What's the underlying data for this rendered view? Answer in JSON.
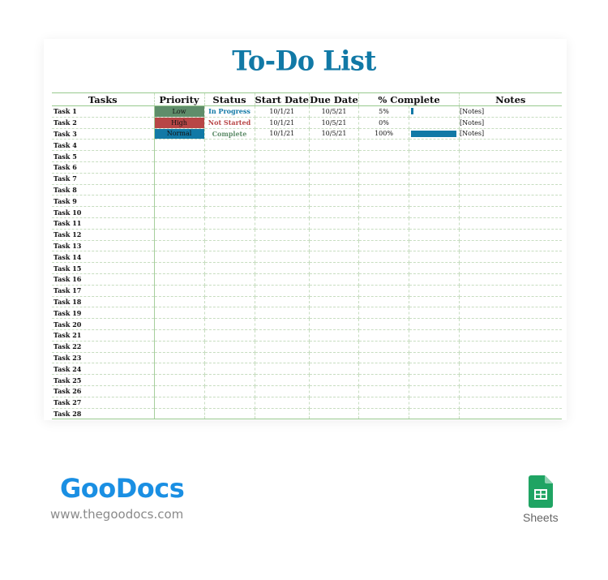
{
  "title": "To-Do List",
  "columns": {
    "tasks": "Tasks",
    "priority": "Priority",
    "status": "Status",
    "start_date": "Start Date",
    "due_date": "Due Date",
    "percent_complete": "% Complete",
    "notes": "Notes"
  },
  "colors": {
    "accent": "#1179a6",
    "priority_low": "#5f8d6a",
    "priority_high": "#b84646",
    "priority_normal": "#1179a6",
    "status_in_progress": "#1179a6",
    "status_not_started": "#b84646",
    "status_complete": "#5f8d6a",
    "grid_line": "#98c98e"
  },
  "rows": [
    {
      "task": "Task 1",
      "priority": "Low",
      "priority_key": "low",
      "status": "In Progress",
      "status_key": "in_progress",
      "start": "10/1/21",
      "due": "10/5/21",
      "pct_label": "5%",
      "pct": 0.05,
      "notes": "[Notes]"
    },
    {
      "task": "Task 2",
      "priority": "High",
      "priority_key": "high",
      "status": "Not Started",
      "status_key": "not_started",
      "start": "10/1/21",
      "due": "10/5/21",
      "pct_label": "0%",
      "pct": 0,
      "notes": "[Notes]"
    },
    {
      "task": "Task 3",
      "priority": "Normal",
      "priority_key": "normal",
      "status": "Complete",
      "status_key": "complete",
      "start": "10/1/21",
      "due": "10/5/21",
      "pct_label": "100%",
      "pct": 1.0,
      "notes": "[Notes]"
    },
    {
      "task": "Task 4"
    },
    {
      "task": "Task 5"
    },
    {
      "task": "Task 6"
    },
    {
      "task": "Task 7"
    },
    {
      "task": "Task 8"
    },
    {
      "task": "Task 9"
    },
    {
      "task": "Task 10"
    },
    {
      "task": "Task 11"
    },
    {
      "task": "Task 12"
    },
    {
      "task": "Task 13"
    },
    {
      "task": "Task 14"
    },
    {
      "task": "Task 15"
    },
    {
      "task": "Task 16"
    },
    {
      "task": "Task 17"
    },
    {
      "task": "Task 18"
    },
    {
      "task": "Task 19"
    },
    {
      "task": "Task 20"
    },
    {
      "task": "Task 21"
    },
    {
      "task": "Task 22"
    },
    {
      "task": "Task 23"
    },
    {
      "task": "Task 24"
    },
    {
      "task": "Task 25"
    },
    {
      "task": "Task 26"
    },
    {
      "task": "Task 27"
    },
    {
      "task": "Task 28"
    }
  ],
  "branding": {
    "logo": "GooDocs",
    "url": "www.thegoodocs.com",
    "app_label": "Sheets",
    "app_icon": "google-sheets-icon"
  }
}
